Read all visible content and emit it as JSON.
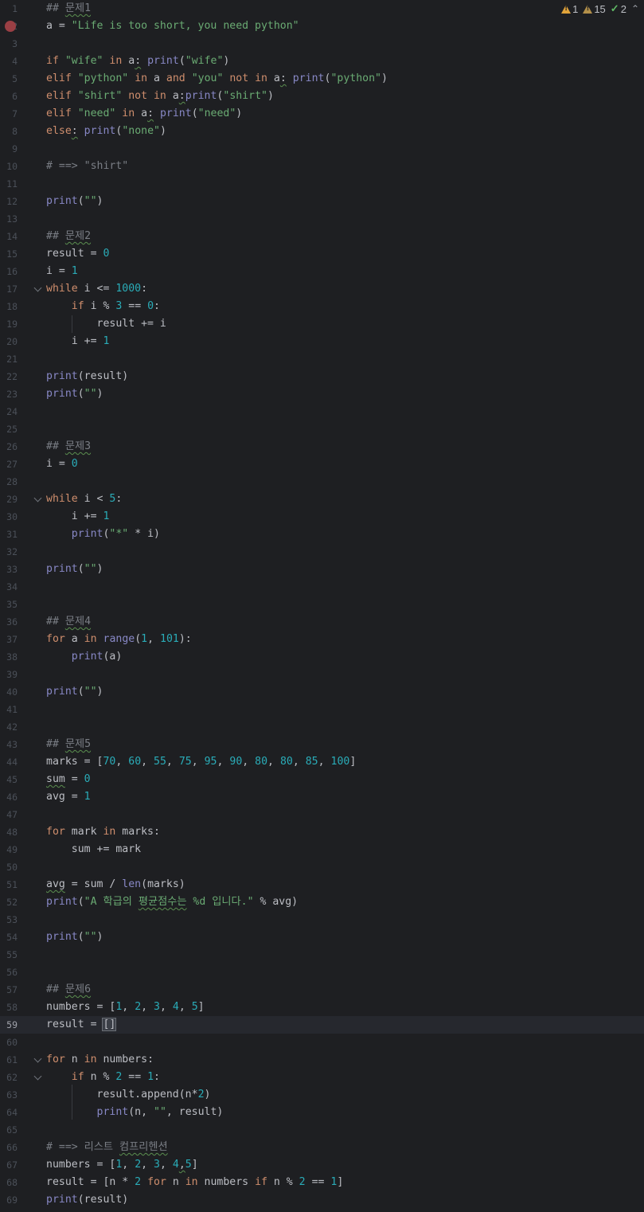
{
  "inspections": {
    "errors": "1",
    "warnings": "15",
    "ok": "2",
    "warn_icon": "warning-triangle-icon",
    "ok_icon": "checkmark-icon",
    "collapse_icon": "chevron-up-icon"
  },
  "current_line": 59,
  "lines": [
    {
      "n": 1,
      "t": [
        [
          "## ",
          "cmt"
        ],
        [
          "문제1",
          "cmt wavy"
        ]
      ]
    },
    {
      "n": 2,
      "bp": true,
      "t": [
        [
          "a = ",
          ""
        ],
        [
          "\"Life is too short, you need python\"",
          "str"
        ]
      ]
    },
    {
      "n": 3,
      "t": []
    },
    {
      "n": 4,
      "t": [
        [
          "if ",
          "kw"
        ],
        [
          "\"wife\"",
          "str"
        ],
        [
          " ",
          ""
        ],
        [
          "in",
          "kw"
        ],
        [
          " a",
          ""
        ],
        [
          ":",
          "wavy"
        ],
        [
          " ",
          ""
        ],
        [
          "print",
          "fn"
        ],
        [
          "(",
          ""
        ],
        [
          "\"wife\"",
          "str"
        ],
        [
          ")",
          ""
        ]
      ]
    },
    {
      "n": 5,
      "t": [
        [
          "elif ",
          "kw"
        ],
        [
          "\"python\"",
          "str"
        ],
        [
          " ",
          ""
        ],
        [
          "in",
          "kw"
        ],
        [
          " a ",
          ""
        ],
        [
          "and",
          "kw"
        ],
        [
          " ",
          ""
        ],
        [
          "\"you\"",
          "str"
        ],
        [
          " ",
          ""
        ],
        [
          "not in",
          "kw"
        ],
        [
          " a",
          ""
        ],
        [
          ":",
          "wavy"
        ],
        [
          " ",
          ""
        ],
        [
          "print",
          "fn"
        ],
        [
          "(",
          ""
        ],
        [
          "\"python\"",
          "str"
        ],
        [
          ")",
          ""
        ]
      ]
    },
    {
      "n": 6,
      "t": [
        [
          "elif ",
          "kw"
        ],
        [
          "\"shirt\"",
          "str"
        ],
        [
          " ",
          ""
        ],
        [
          "not in",
          "kw"
        ],
        [
          " a",
          ""
        ],
        [
          ":",
          "wavy"
        ],
        [
          "print",
          "fn"
        ],
        [
          "(",
          ""
        ],
        [
          "\"shirt\"",
          "str"
        ],
        [
          ")",
          ""
        ]
      ]
    },
    {
      "n": 7,
      "t": [
        [
          "elif ",
          "kw"
        ],
        [
          "\"need\"",
          "str"
        ],
        [
          " ",
          ""
        ],
        [
          "in",
          "kw"
        ],
        [
          " a",
          ""
        ],
        [
          ":",
          "wavy"
        ],
        [
          " ",
          ""
        ],
        [
          "print",
          "fn"
        ],
        [
          "(",
          ""
        ],
        [
          "\"need\"",
          "str"
        ],
        [
          ")",
          ""
        ]
      ]
    },
    {
      "n": 8,
      "t": [
        [
          "else",
          "kw"
        ],
        [
          ":",
          "wavy"
        ],
        [
          " ",
          ""
        ],
        [
          "print",
          "fn"
        ],
        [
          "(",
          ""
        ],
        [
          "\"none\"",
          "str"
        ],
        [
          ")",
          ""
        ]
      ]
    },
    {
      "n": 9,
      "t": []
    },
    {
      "n": 10,
      "t": [
        [
          "# ==> \"shirt\"",
          "cmt"
        ]
      ]
    },
    {
      "n": 11,
      "t": []
    },
    {
      "n": 12,
      "t": [
        [
          "print",
          "fn"
        ],
        [
          "(",
          ""
        ],
        [
          "\"\"",
          "str"
        ],
        [
          ")",
          ""
        ]
      ]
    },
    {
      "n": 13,
      "t": []
    },
    {
      "n": 14,
      "t": [
        [
          "## ",
          "cmt"
        ],
        [
          "문제2",
          "cmt wavy"
        ]
      ]
    },
    {
      "n": 15,
      "t": [
        [
          "result = ",
          ""
        ],
        [
          "0",
          "num"
        ]
      ]
    },
    {
      "n": 16,
      "t": [
        [
          "i = ",
          ""
        ],
        [
          "1",
          "num"
        ]
      ]
    },
    {
      "n": 17,
      "fold": true,
      "t": [
        [
          "while",
          "kw"
        ],
        [
          " i <= ",
          ""
        ],
        [
          "1000",
          "num"
        ],
        [
          ":",
          ""
        ]
      ]
    },
    {
      "n": 18,
      "t": [
        [
          "    ",
          ""
        ],
        [
          "if",
          "kw"
        ],
        [
          " i % ",
          ""
        ],
        [
          "3",
          "num"
        ],
        [
          " == ",
          ""
        ],
        [
          "0",
          "num"
        ],
        [
          ":",
          ""
        ]
      ]
    },
    {
      "n": 19,
      "t": [
        [
          "        result += i",
          ""
        ]
      ]
    },
    {
      "n": 20,
      "t": [
        [
          "    i += ",
          ""
        ],
        [
          "1",
          "num"
        ]
      ]
    },
    {
      "n": 21,
      "t": []
    },
    {
      "n": 22,
      "t": [
        [
          "print",
          "fn"
        ],
        [
          "(result)",
          ""
        ]
      ]
    },
    {
      "n": 23,
      "t": [
        [
          "print",
          "fn"
        ],
        [
          "(",
          ""
        ],
        [
          "\"\"",
          "str"
        ],
        [
          ")",
          ""
        ]
      ]
    },
    {
      "n": 24,
      "t": []
    },
    {
      "n": 25,
      "t": []
    },
    {
      "n": 26,
      "t": [
        [
          "## ",
          "cmt"
        ],
        [
          "문제3",
          "cmt wavy"
        ]
      ]
    },
    {
      "n": 27,
      "t": [
        [
          "i = ",
          ""
        ],
        [
          "0",
          "num"
        ]
      ]
    },
    {
      "n": 28,
      "t": []
    },
    {
      "n": 29,
      "fold": true,
      "t": [
        [
          "while",
          "kw"
        ],
        [
          " i < ",
          ""
        ],
        [
          "5",
          "num"
        ],
        [
          ":",
          ""
        ]
      ]
    },
    {
      "n": 30,
      "t": [
        [
          "    i += ",
          ""
        ],
        [
          "1",
          "num"
        ]
      ]
    },
    {
      "n": 31,
      "t": [
        [
          "    ",
          ""
        ],
        [
          "print",
          "fn"
        ],
        [
          "(",
          ""
        ],
        [
          "\"*\"",
          "str"
        ],
        [
          " * i)",
          ""
        ]
      ]
    },
    {
      "n": 32,
      "t": []
    },
    {
      "n": 33,
      "t": [
        [
          "print",
          "fn"
        ],
        [
          "(",
          ""
        ],
        [
          "\"\"",
          "str"
        ],
        [
          ")",
          ""
        ]
      ]
    },
    {
      "n": 34,
      "t": []
    },
    {
      "n": 35,
      "t": []
    },
    {
      "n": 36,
      "t": [
        [
          "## ",
          "cmt"
        ],
        [
          "문제4",
          "cmt wavy"
        ]
      ]
    },
    {
      "n": 37,
      "t": [
        [
          "for",
          "kw"
        ],
        [
          " a ",
          ""
        ],
        [
          "in",
          "kw"
        ],
        [
          " ",
          ""
        ],
        [
          "range",
          "fn"
        ],
        [
          "(",
          ""
        ],
        [
          "1",
          "num"
        ],
        [
          ", ",
          ""
        ],
        [
          "101",
          "num"
        ],
        [
          "):",
          ""
        ]
      ]
    },
    {
      "n": 38,
      "t": [
        [
          "    ",
          ""
        ],
        [
          "print",
          "fn"
        ],
        [
          "(a)",
          ""
        ]
      ]
    },
    {
      "n": 39,
      "t": []
    },
    {
      "n": 40,
      "t": [
        [
          "print",
          "fn"
        ],
        [
          "(",
          ""
        ],
        [
          "\"\"",
          "str"
        ],
        [
          ")",
          ""
        ]
      ]
    },
    {
      "n": 41,
      "t": []
    },
    {
      "n": 42,
      "t": []
    },
    {
      "n": 43,
      "t": [
        [
          "## ",
          "cmt"
        ],
        [
          "문제5",
          "cmt wavy"
        ]
      ]
    },
    {
      "n": 44,
      "t": [
        [
          "marks = [",
          ""
        ],
        [
          "70",
          "num"
        ],
        [
          ", ",
          ""
        ],
        [
          "60",
          "num"
        ],
        [
          ", ",
          ""
        ],
        [
          "55",
          "num"
        ],
        [
          ", ",
          ""
        ],
        [
          "75",
          "num"
        ],
        [
          ", ",
          ""
        ],
        [
          "95",
          "num"
        ],
        [
          ", ",
          ""
        ],
        [
          "90",
          "num"
        ],
        [
          ", ",
          ""
        ],
        [
          "80",
          "num"
        ],
        [
          ", ",
          ""
        ],
        [
          "80",
          "num"
        ],
        [
          ", ",
          ""
        ],
        [
          "85",
          "num"
        ],
        [
          ", ",
          ""
        ],
        [
          "100",
          "num"
        ],
        [
          "]",
          ""
        ]
      ]
    },
    {
      "n": 45,
      "t": [
        [
          "sum",
          "wavy"
        ],
        [
          " = ",
          ""
        ],
        [
          "0",
          "num"
        ]
      ]
    },
    {
      "n": 46,
      "t": [
        [
          "avg = ",
          ""
        ],
        [
          "1",
          "num"
        ]
      ]
    },
    {
      "n": 47,
      "t": []
    },
    {
      "n": 48,
      "t": [
        [
          "for",
          "kw"
        ],
        [
          " mark ",
          ""
        ],
        [
          "in",
          "kw"
        ],
        [
          " marks:",
          ""
        ]
      ]
    },
    {
      "n": 49,
      "t": [
        [
          "    sum += mark",
          ""
        ]
      ]
    },
    {
      "n": 50,
      "t": []
    },
    {
      "n": 51,
      "t": [
        [
          "avg",
          "wavy"
        ],
        [
          " = sum / ",
          ""
        ],
        [
          "len",
          "fn"
        ],
        [
          "(marks)",
          ""
        ]
      ]
    },
    {
      "n": 52,
      "t": [
        [
          "print",
          "fn"
        ],
        [
          "(",
          ""
        ],
        [
          "\"A 학급의 ",
          "str"
        ],
        [
          "평균점수는",
          "str wavy"
        ],
        [
          " %d 입니다.\"",
          "str"
        ],
        [
          " % avg)",
          ""
        ]
      ]
    },
    {
      "n": 53,
      "t": []
    },
    {
      "n": 54,
      "t": [
        [
          "print",
          "fn"
        ],
        [
          "(",
          ""
        ],
        [
          "\"\"",
          "str"
        ],
        [
          ")",
          ""
        ]
      ]
    },
    {
      "n": 55,
      "t": []
    },
    {
      "n": 56,
      "t": []
    },
    {
      "n": 57,
      "t": [
        [
          "## ",
          "cmt"
        ],
        [
          "문제6",
          "cmt wavy"
        ]
      ]
    },
    {
      "n": 58,
      "t": [
        [
          "numbers = [",
          ""
        ],
        [
          "1",
          "num"
        ],
        [
          ", ",
          ""
        ],
        [
          "2",
          "num"
        ],
        [
          ", ",
          ""
        ],
        [
          "3",
          "num"
        ],
        [
          ", ",
          ""
        ],
        [
          "4",
          "num"
        ],
        [
          ", ",
          ""
        ],
        [
          "5",
          "num"
        ],
        [
          "]",
          ""
        ]
      ]
    },
    {
      "n": 59,
      "t": [
        [
          "result = ",
          ""
        ],
        [
          "[]",
          "bracket"
        ]
      ]
    },
    {
      "n": 60,
      "t": []
    },
    {
      "n": 61,
      "fold": true,
      "t": [
        [
          "for",
          "kw"
        ],
        [
          " n ",
          ""
        ],
        [
          "in",
          "kw"
        ],
        [
          " numbers:",
          ""
        ]
      ]
    },
    {
      "n": 62,
      "fold": true,
      "t": [
        [
          "    ",
          ""
        ],
        [
          "if",
          "kw"
        ],
        [
          " n % ",
          ""
        ],
        [
          "2",
          "num"
        ],
        [
          " == ",
          ""
        ],
        [
          "1",
          "num"
        ],
        [
          ":",
          ""
        ]
      ]
    },
    {
      "n": 63,
      "t": [
        [
          "        result.append(n*",
          ""
        ],
        [
          "2",
          "num"
        ],
        [
          ")",
          ""
        ]
      ]
    },
    {
      "n": 64,
      "t": [
        [
          "        ",
          ""
        ],
        [
          "print",
          "fn"
        ],
        [
          "(n, ",
          ""
        ],
        [
          "\"\"",
          "str"
        ],
        [
          ", result)",
          ""
        ]
      ]
    },
    {
      "n": 65,
      "t": []
    },
    {
      "n": 66,
      "t": [
        [
          "# ==> 리스트 ",
          "cmt"
        ],
        [
          "컴프리헨션",
          "cmt wavy"
        ]
      ]
    },
    {
      "n": 67,
      "t": [
        [
          "numbers = [",
          ""
        ],
        [
          "1",
          "num"
        ],
        [
          ", ",
          ""
        ],
        [
          "2",
          "num"
        ],
        [
          ", ",
          ""
        ],
        [
          "3",
          "num"
        ],
        [
          ", ",
          ""
        ],
        [
          "4",
          "num"
        ],
        [
          ",",
          "wavy"
        ],
        [
          "5",
          "num"
        ],
        [
          "]",
          ""
        ]
      ]
    },
    {
      "n": 68,
      "t": [
        [
          "result = [n * ",
          ""
        ],
        [
          "2",
          "num"
        ],
        [
          " ",
          ""
        ],
        [
          "for",
          "kw"
        ],
        [
          " n ",
          ""
        ],
        [
          "in",
          "kw"
        ],
        [
          " numbers ",
          ""
        ],
        [
          "if",
          "kw"
        ],
        [
          " n % ",
          ""
        ],
        [
          "2",
          "num"
        ],
        [
          " == ",
          ""
        ],
        [
          "1",
          "num"
        ],
        [
          "]",
          ""
        ]
      ]
    },
    {
      "n": 69,
      "t": [
        [
          "print",
          "fn"
        ],
        [
          "(result)",
          ""
        ]
      ]
    }
  ]
}
